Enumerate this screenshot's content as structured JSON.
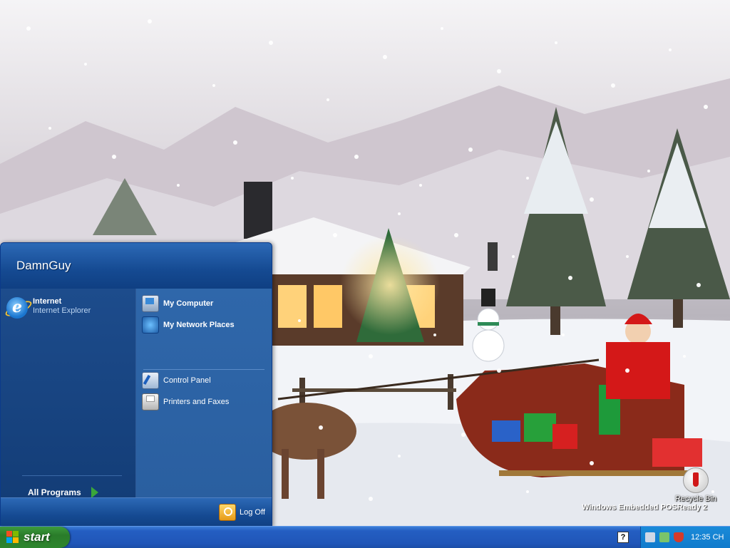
{
  "desktop": {
    "recycle_bin_label": "Recycle Bin",
    "watermark": "Windows Embedded POSReady 2"
  },
  "start_menu": {
    "user_name": "DamnGuy",
    "pinned": {
      "title": "Internet",
      "subtitle": "Internet Explorer"
    },
    "all_programs": "All Programs",
    "right_items": [
      {
        "label": "My Computer",
        "icon": "computer-icon"
      },
      {
        "label": "My Network Places",
        "icon": "network-icon"
      },
      {
        "label": "Control Panel",
        "icon": "control-panel-icon"
      },
      {
        "label": "Printers and Faxes",
        "icon": "printer-icon"
      }
    ],
    "log_off": "Log Off"
  },
  "taskbar": {
    "start_label": "start",
    "help_glyph": "?",
    "clock": "12:35 CH"
  },
  "colors": {
    "taskbar_blue": "#245ec2",
    "start_green": "#2a7c2a",
    "menu_blue": "#1f4a86"
  }
}
